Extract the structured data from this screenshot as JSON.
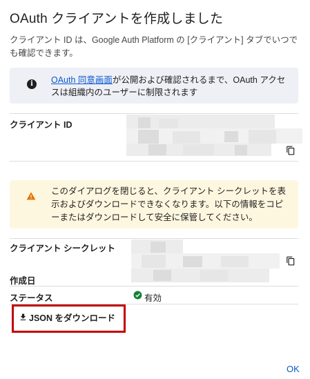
{
  "dialog": {
    "title": "OAuth クライアントを作成しました",
    "description": "クライアント ID は、Google Auth Platform の [クライアント] タブでいつでも確認できます。"
  },
  "info_banner": {
    "icon": "info-icon",
    "link_text": "OAuth 同意画面",
    "text_rest": "が公開および確認されるまで、OAuth アクセスは組織内のユーザーに制限されます"
  },
  "client_id": {
    "label": "クライアント ID",
    "copy_icon": "copy-icon"
  },
  "warning_banner": {
    "icon": "warning-icon",
    "text": "このダイアログを閉じると、クライアント シークレットを表示およびダウンロードできなくなります。以下の情報をコピーまたはダウンロードして安全に保管してください。",
    "color": "#fef7e0"
  },
  "client_secret": {
    "label": "クライアント シークレット",
    "copy_icon": "copy-icon"
  },
  "created_date": {
    "label": "作成日"
  },
  "status": {
    "label": "ステータス",
    "value": "有効",
    "icon": "check-circle-icon",
    "color": "#188038"
  },
  "download_button": {
    "label": "JSON をダウンロード",
    "icon": "download-icon"
  },
  "highlight_color": "#c00000",
  "ok_button": {
    "label": "OK"
  }
}
